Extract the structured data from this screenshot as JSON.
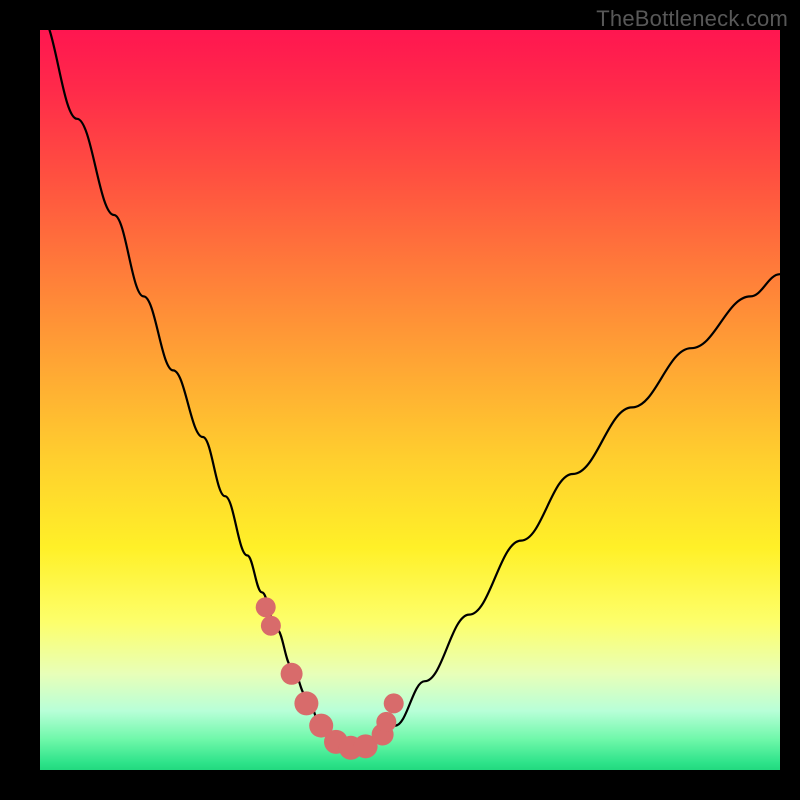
{
  "watermark": "TheBottleneck.com",
  "chart_data": {
    "type": "line",
    "title": "",
    "xlabel": "",
    "ylabel": "",
    "xlim": [
      0,
      100
    ],
    "ylim": [
      0,
      100
    ],
    "series": [
      {
        "name": "bottleneck-curve",
        "x": [
          0,
          5,
          10,
          14,
          18,
          22,
          25,
          28,
          30,
          32,
          34,
          36,
          38,
          40,
          42,
          44,
          46,
          48,
          52,
          58,
          65,
          72,
          80,
          88,
          96,
          100
        ],
        "values": [
          102,
          88,
          75,
          64,
          54,
          45,
          37,
          29,
          24,
          19,
          14,
          10,
          6,
          4,
          3,
          3,
          4,
          6,
          12,
          21,
          31,
          40,
          49,
          57,
          64,
          67
        ]
      }
    ],
    "markers": {
      "name": "highlight-points",
      "color": "#d86b6b",
      "x": [
        30.5,
        31.2,
        34.0,
        36.0,
        38.0,
        40.0,
        42.0,
        44.0,
        46.3,
        46.8,
        47.8
      ],
      "values": [
        22.0,
        19.5,
        13.0,
        9.0,
        6.0,
        3.8,
        3.0,
        3.2,
        4.8,
        6.5,
        9.0
      ],
      "radius": [
        10,
        10,
        11,
        12,
        12,
        12,
        12,
        12,
        11,
        10,
        10
      ]
    },
    "gradient_bands": [
      {
        "stop": 0.0,
        "color": "#ff1650"
      },
      {
        "stop": 0.45,
        "color": "#ffa534"
      },
      {
        "stop": 0.7,
        "color": "#fff028"
      },
      {
        "stop": 0.92,
        "color": "#b8ffd8"
      },
      {
        "stop": 1.0,
        "color": "#22d97f"
      }
    ]
  }
}
